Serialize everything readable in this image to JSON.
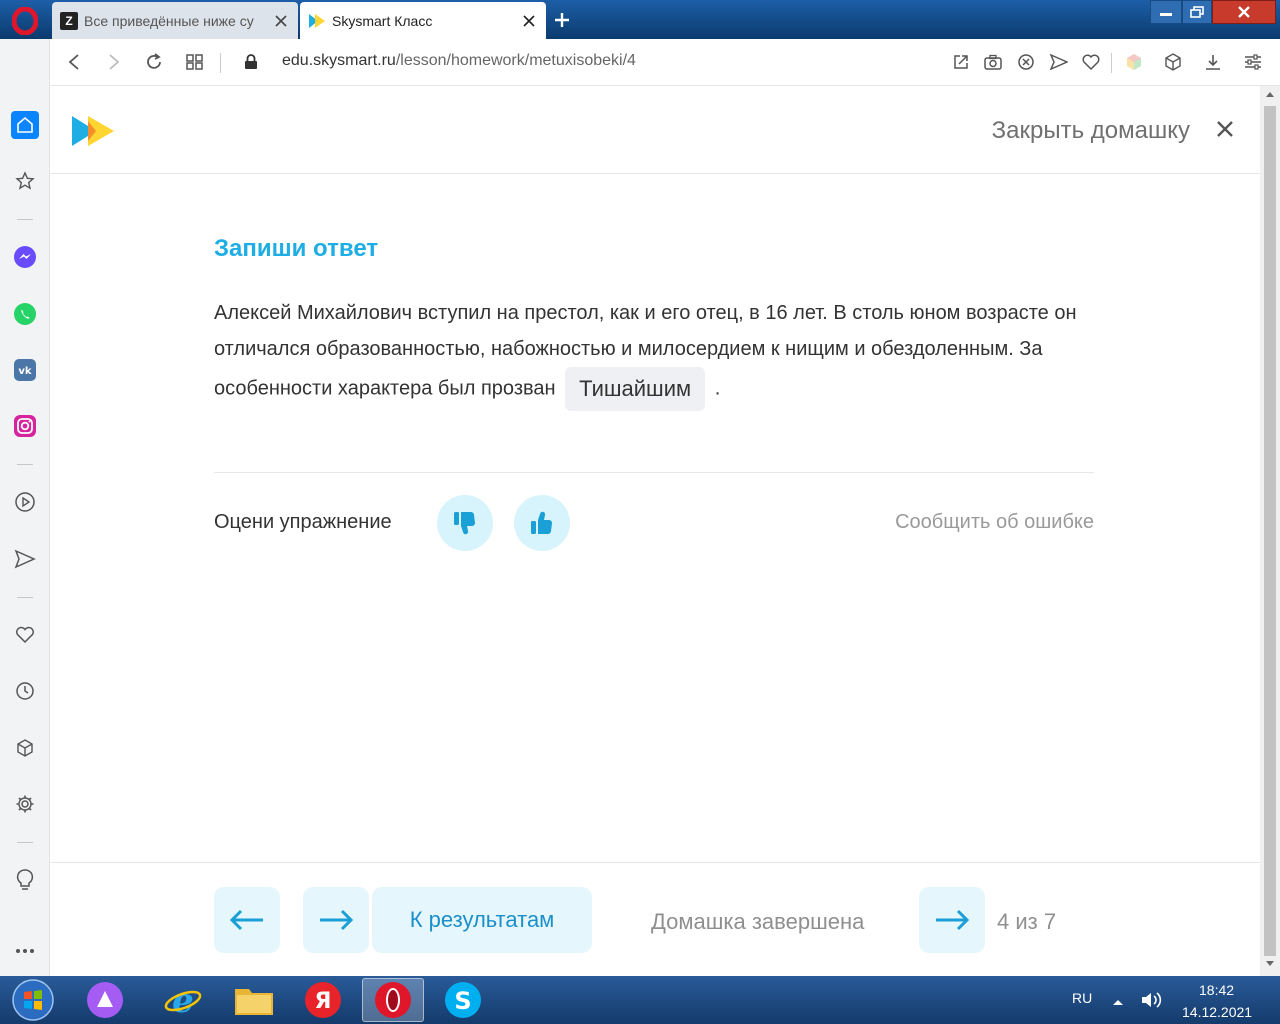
{
  "browser": {
    "tabs": [
      {
        "title": "Все приведённые ниже су",
        "favicon": "Z"
      },
      {
        "title": "Skysmart Класс"
      }
    ],
    "url_host": "edu.skysmart.ru",
    "url_path": "/lesson/homework/metuxisobeki/4"
  },
  "page": {
    "close_homework": "Закрыть домашку",
    "task_title": "Запиши ответ",
    "text_before": "Алексей Михайлович вступил на престол, как и его отец, в 16 лет. В столь юном возрасте он отличался образованностью, набожностью и милосердием к нищим и обездоленным. За особенности характера был прозван",
    "answer": "Тишайшим",
    "text_after": ".",
    "rate_label": "Оцени упражнение",
    "report_error": "Сообщить об ошибке",
    "results_button": "К результатам",
    "done_label": "Домашка завершена",
    "counter": "4 из 7"
  },
  "taskbar": {
    "lang": "RU",
    "time": "18:42",
    "date": "14.12.2021"
  },
  "colors": {
    "accent": "#1eaee3",
    "button_bg": "#e5f7fd",
    "rate_bg": "#d7f3fb",
    "icon_blue": "#1a9fd6"
  }
}
